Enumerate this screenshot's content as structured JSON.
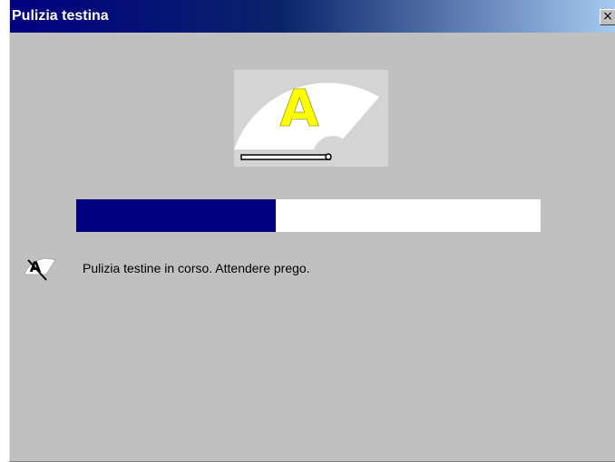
{
  "window": {
    "title": "Pulizia testina",
    "close_glyph": "×"
  },
  "animation": {
    "icon": "print-head-cleaning-icon",
    "letter": "A",
    "letter_color": "#ffff00"
  },
  "progress": {
    "fraction": 0.43,
    "fill_color": "#000080",
    "track_color": "#ffffff"
  },
  "status": {
    "icon": "print-head-cleaning-small-icon",
    "text": "Pulizia testine in corso. Attendere prego."
  }
}
